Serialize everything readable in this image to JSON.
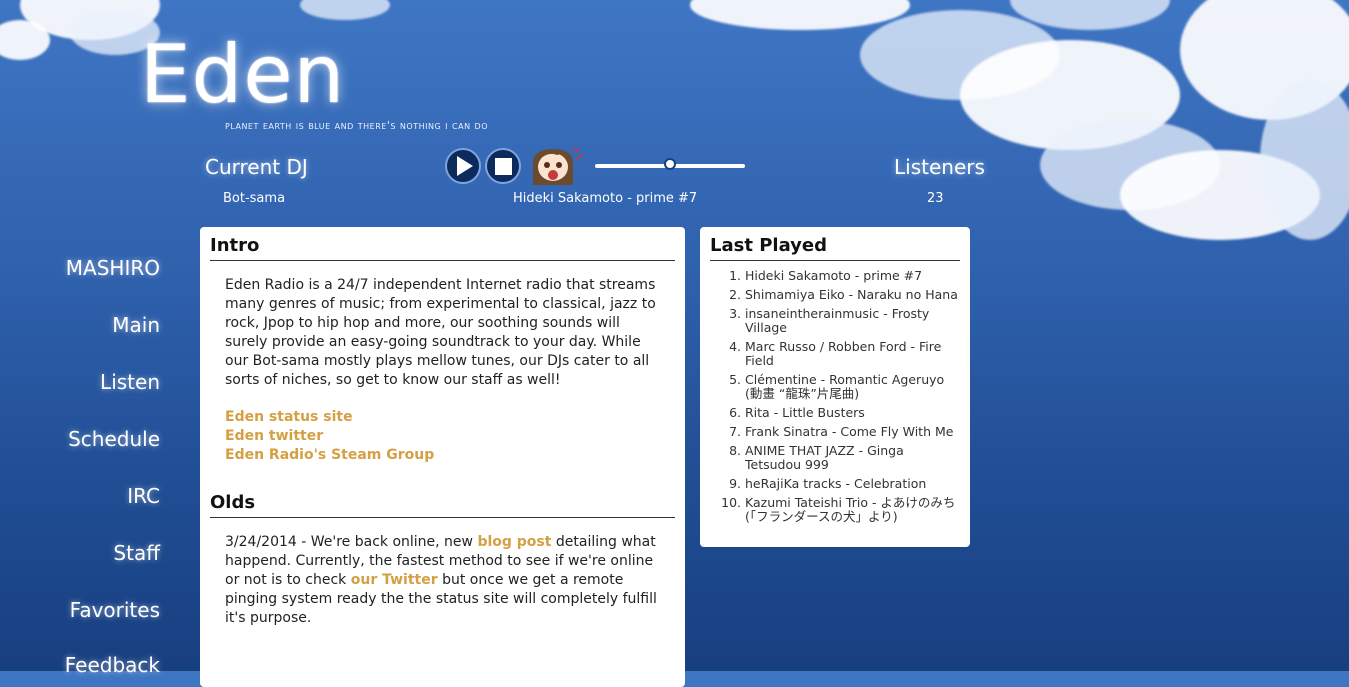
{
  "brand": {
    "title": "Eden",
    "tagline": "Planet Earth is blue and there's nothing I can do"
  },
  "header": {
    "current_dj_label": "Current DJ",
    "current_dj": "Bot-sama",
    "now_playing": "Hideki Sakamoto - prime #7",
    "listeners_label": "Listeners",
    "listeners_count": "23",
    "volume": 0.5
  },
  "nav": {
    "items": [
      "MASHIRO",
      "Main",
      "Listen",
      "Schedule",
      "IRC",
      "Staff",
      "Favorites",
      "Feedback"
    ]
  },
  "intro": {
    "heading": "Intro",
    "body": "Eden Radio is a 24/7 independent Internet radio that streams many genres of music; from experimental to classical, jazz to rock, Jpop to hip hop and more, our soothing sounds will surely provide an easy-going soundtrack to your day. While our Bot-sama mostly plays mellow tunes, our DJs cater to all sorts of niches, so get to know our staff as well!",
    "links": [
      "Eden status site",
      "Eden twitter",
      "Eden Radio's Steam Group"
    ]
  },
  "olds": {
    "heading": "Olds",
    "p1": "3/24/2014 - We're back online, new ",
    "link1": "blog post",
    "p2": " detailing what happend. Currently, the fastest method to see if we're online or not is to check ",
    "link2": "our Twitter",
    "p3": " but once we get a remote pinging system ready the the status site will completely fulfill it's purpose."
  },
  "last_played": {
    "heading": "Last Played",
    "tracks": [
      "Hideki Sakamoto - prime #7",
      "Shimamiya Eiko - Naraku no Hana",
      "insaneintherainmusic - Frosty Village",
      "Marc Russo / Robben Ford - Fire Field",
      "Clémentine - Romantic Ageruyo (動畫 “龍珠”片尾曲)",
      "Rita - Little Busters",
      "Frank Sinatra - Come Fly With Me",
      "ANIME THAT JAZZ - Ginga Tetsudou 999",
      "heRajiKa tracks - Celebration",
      "Kazumi Tateishi Trio - よあけのみち (「フランダースの犬」より)"
    ]
  }
}
